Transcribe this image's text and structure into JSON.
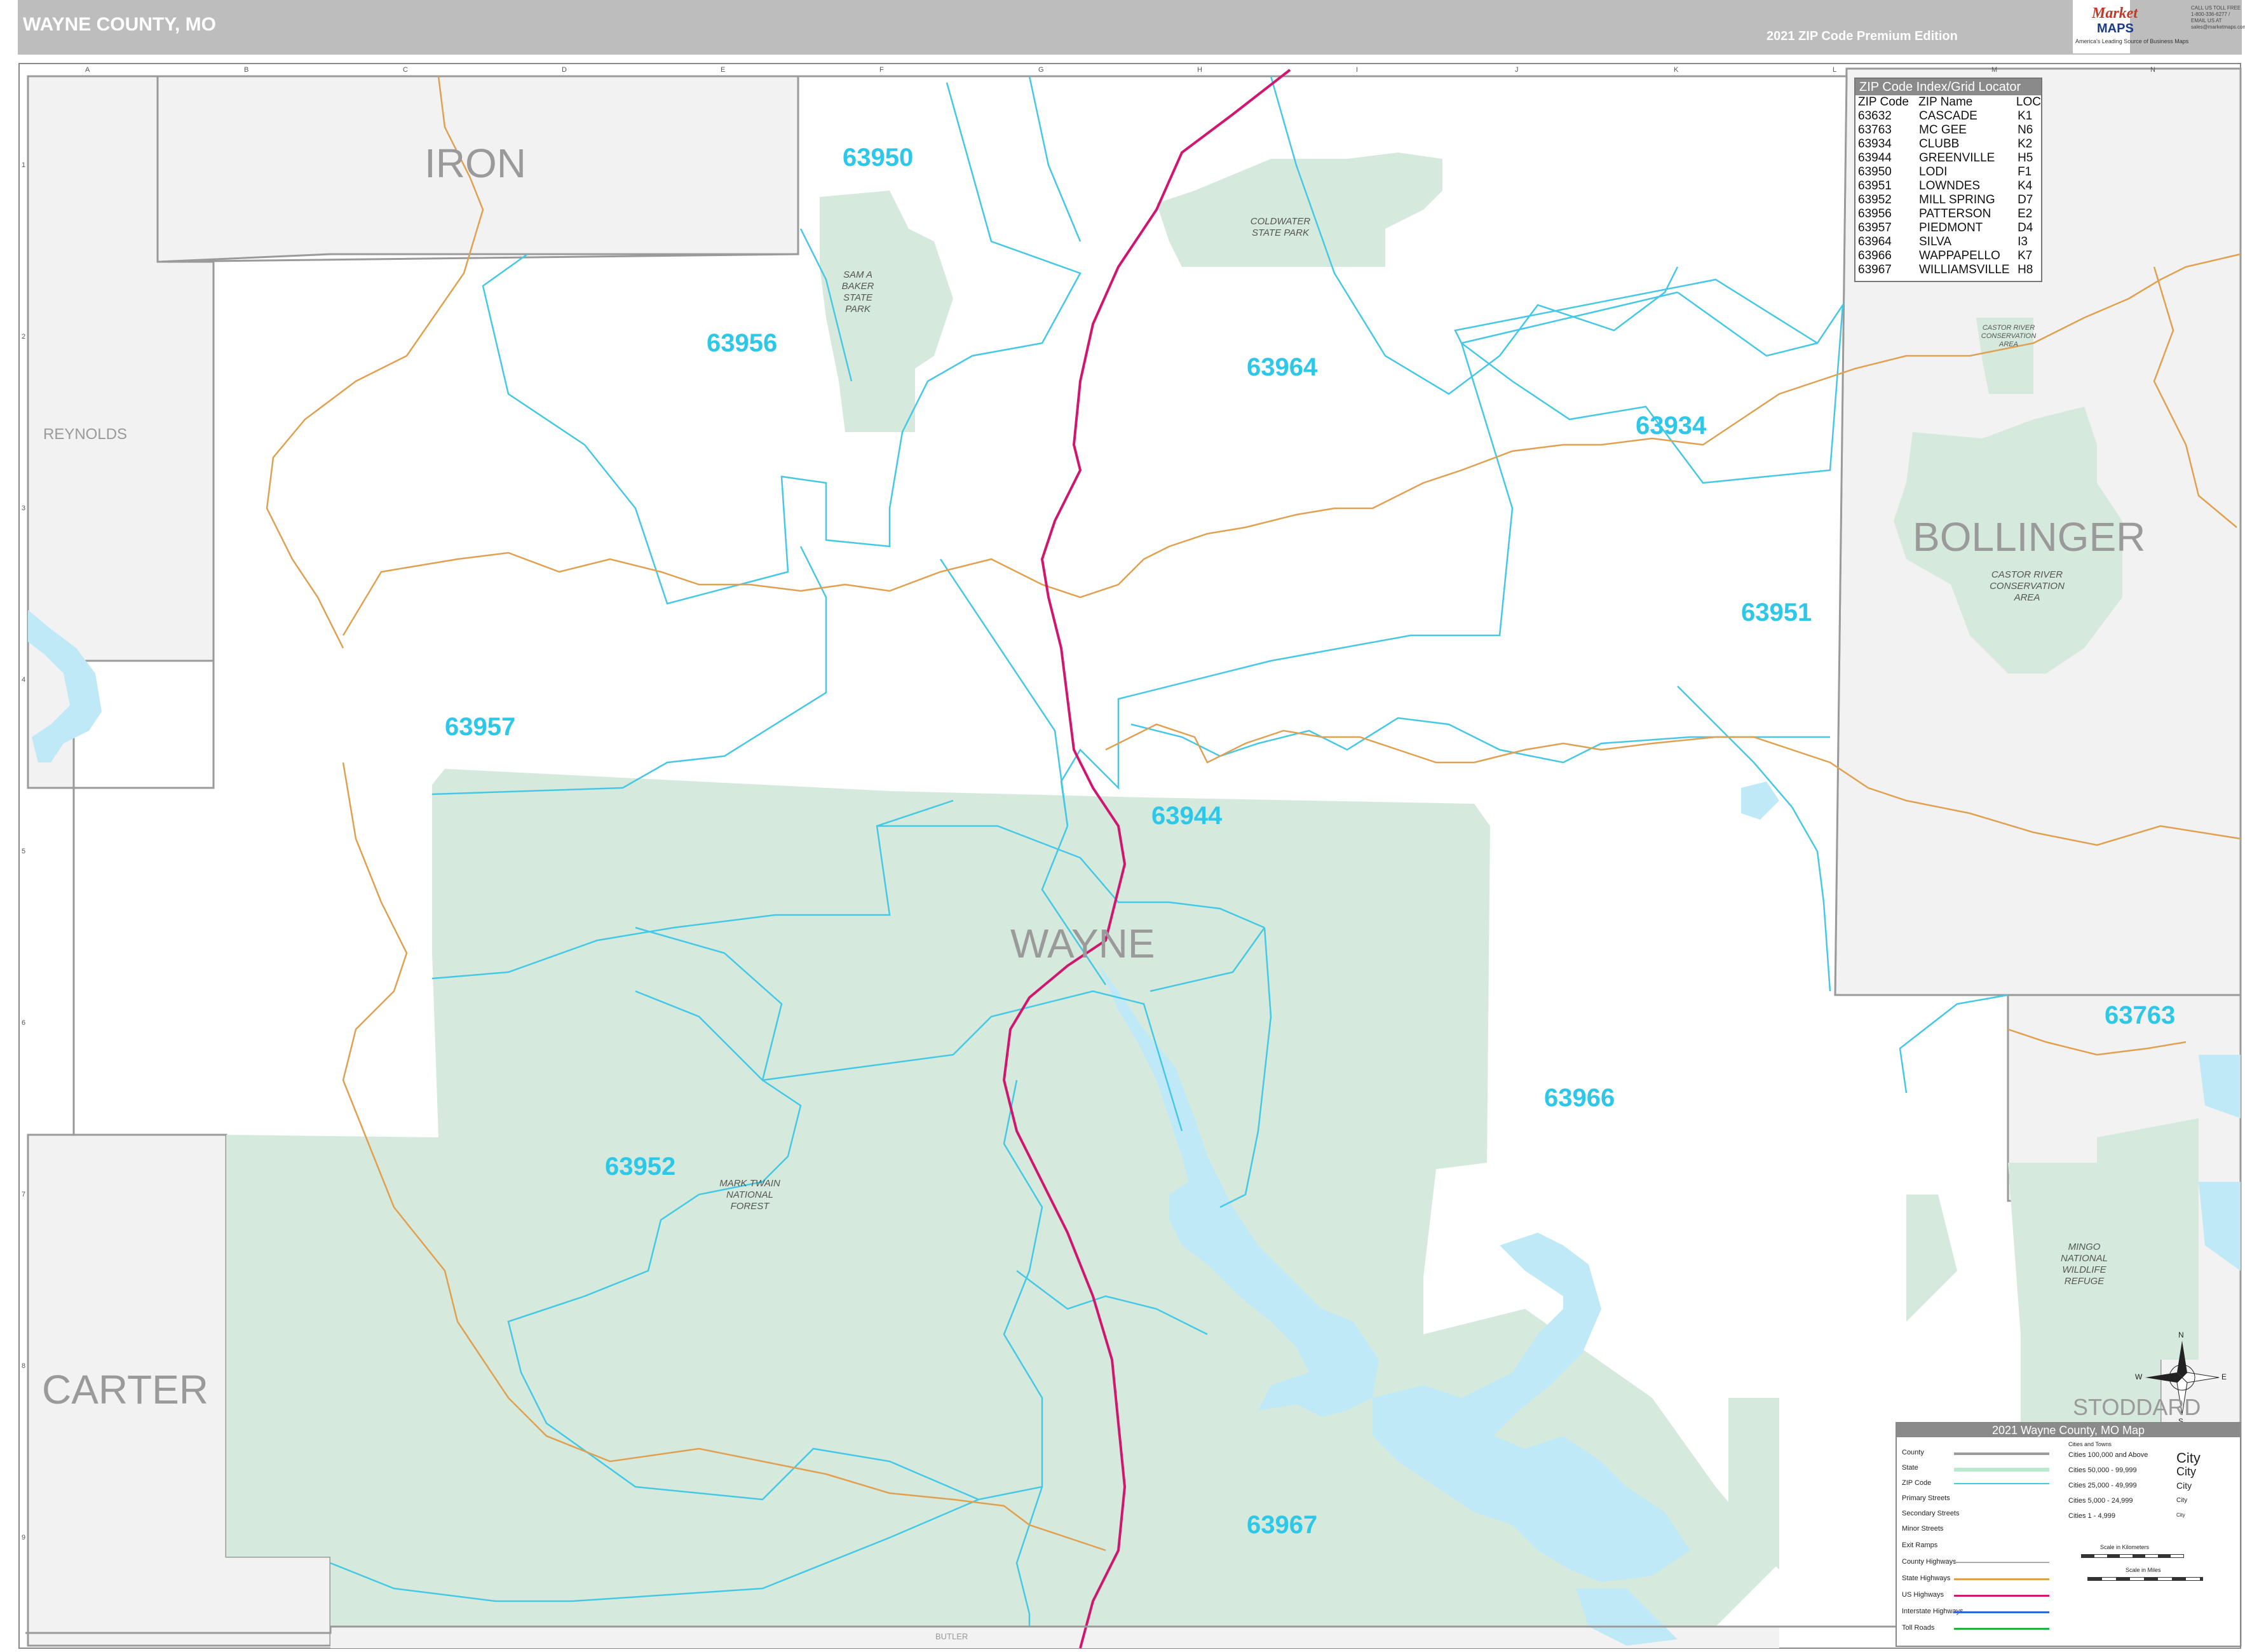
{
  "header": {
    "title": "WAYNE COUNTY, MO",
    "edition": "2021 ZIP Code Premium Edition",
    "logo_line1": "Market",
    "logo_line2": "MAPS",
    "logo_tagline": "America's Leading Source of Business Maps",
    "phone": "CALL US TOLL FREE 1-800-336-6277 / EMAIL US AT sales@marketmaps.com"
  },
  "grid": {
    "letters": [
      "A",
      "B",
      "C",
      "D",
      "E",
      "F",
      "G",
      "H",
      "I",
      "J",
      "K",
      "L",
      "M",
      "N"
    ],
    "numbers": [
      "1",
      "2",
      "3",
      "4",
      "5",
      "6",
      "7",
      "8",
      "9"
    ]
  },
  "counties": {
    "iron": "IRON",
    "reynolds": "REYNOLDS",
    "bollinger": "BOLLINGER",
    "wayne": "WAYNE",
    "carter": "CARTER",
    "stoddard": "STODDARD",
    "butler": "BUTLER"
  },
  "zips": {
    "z63950": "63950",
    "z63956": "63956",
    "z63964": "63964",
    "z63934": "63934",
    "z63951": "63951",
    "z63957": "63957",
    "z63944": "63944",
    "z63763": "63763",
    "z63966": "63966",
    "z63952": "63952",
    "z63967": "63967"
  },
  "parks": {
    "sam_baker": "SAM A BAKER STATE PARK",
    "coldwater": "COLDWATER STATE PARK",
    "castor_river": "CASTOR RIVER CONSERVATION AREA",
    "castor_river_north": "CASTOR RIVER CONSERVATION AREA",
    "mark_twain": "MARK TWAIN NATIONAL FOREST",
    "mingo": "MINGO NATIONAL WILDLIFE REFUGE"
  },
  "zip_index": {
    "title": "ZIP Code Index/Grid Locator",
    "headers": [
      "ZIP Code",
      "ZIP Name",
      "LOC"
    ],
    "rows": [
      [
        "63632",
        "CASCADE",
        "K1"
      ],
      [
        "63763",
        "MC GEE",
        "N6"
      ],
      [
        "63934",
        "CLUBB",
        "K2"
      ],
      [
        "63944",
        "GREENVILLE",
        "H5"
      ],
      [
        "63950",
        "LODI",
        "F1"
      ],
      [
        "63951",
        "LOWNDES",
        "K4"
      ],
      [
        "63952",
        "MILL SPRING",
        "D7"
      ],
      [
        "63956",
        "PATTERSON",
        "E2"
      ],
      [
        "63957",
        "PIEDMONT",
        "D4"
      ],
      [
        "63964",
        "SILVA",
        "I3"
      ],
      [
        "63966",
        "WAPPAPELLO",
        "K7"
      ],
      [
        "63967",
        "WILLIAMSVILLE",
        "H8"
      ]
    ]
  },
  "legend": {
    "title": "2021 Wayne County, MO Map",
    "items": [
      "County",
      "State",
      "ZIP Code",
      "Primary Streets",
      "Secondary Streets",
      "Minor Streets",
      "Exit Ramps",
      "County Highways",
      "State Highways",
      "US Highways",
      "Interstate Highways",
      "Toll Roads"
    ],
    "cities_header": "Cities and Towns",
    "cities": [
      "Cities 100,000 and Above",
      "Cities 50,000 - 99,999",
      "Cities 25,000 - 49,999",
      "Cities 5,000 - 24,999",
      "Cities 1 - 4,999"
    ],
    "city_samples": [
      "City",
      "City",
      "City",
      "City",
      "City"
    ],
    "scale_km": "Scale in Kilometers",
    "scale_mi": "Scale in Miles"
  },
  "compass": {
    "n": "N",
    "s": "S",
    "e": "E",
    "w": "W"
  },
  "colors": {
    "forest": "#d5eadd",
    "forest_dark": "#b7dcc4",
    "water": "#bfe9f7",
    "water_strong": "#a9e2f5",
    "zip_line": "#45c8e6",
    "us_highway": "#d1166f",
    "state_highway": "#e0a050",
    "outside_county": "#f2f2f2",
    "county_border": "#9a9a9a"
  }
}
